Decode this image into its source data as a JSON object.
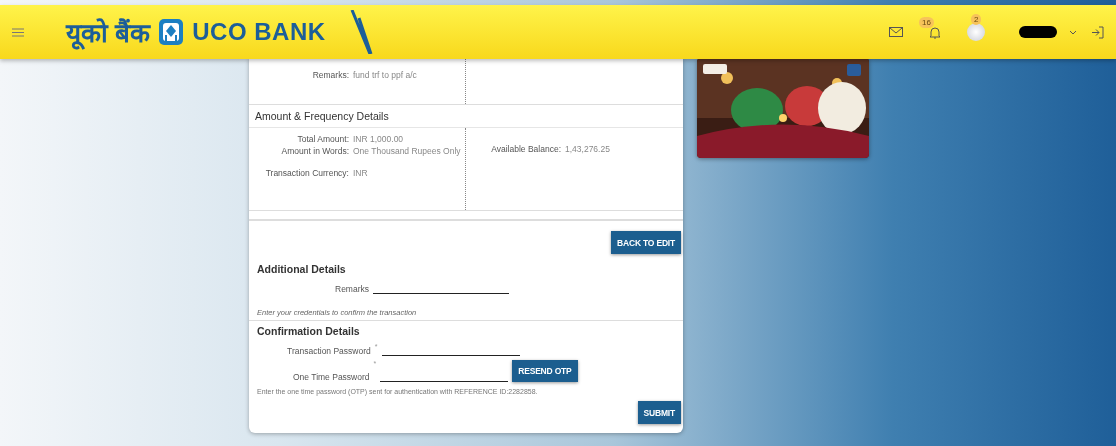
{
  "header": {
    "brand_hindi": "यूको बैंक",
    "brand_english": "UCO BANK",
    "notifications_count": "16",
    "profile_count": "2"
  },
  "summary": {
    "top_rows": [
      {
        "label": "Remarks:",
        "value": "fund trf to ppf a/c"
      }
    ],
    "amount_title": "Amount & Frequency Details",
    "left_rows": [
      {
        "label": "Total Amount:",
        "value": "INR 1,000.00"
      },
      {
        "label": "Amount in Words:",
        "value": "One Thousand Rupees Only"
      },
      {
        "label": "Transaction Currency:",
        "value": "INR"
      }
    ],
    "right_rows": [
      {
        "label": "Available Balance:",
        "value": "1,43,276.25"
      }
    ]
  },
  "back_button": "BACK TO EDIT",
  "additional": {
    "title": "Additional Details",
    "remarks_label": "Remarks"
  },
  "instruction": "Enter your credentials to confirm the transaction",
  "confirmation": {
    "title": "Confirmation Details",
    "fields": [
      {
        "kind": "password",
        "label": "Transaction Password",
        "required_mark": "*"
      },
      {
        "kind": "otp",
        "label": "One Time Password",
        "required_mark": "*"
      }
    ],
    "resend_button": "RESEND OTP",
    "note": "Enter the one time password (OTP) sent for authentication with REFERENCE ID:2282858."
  },
  "submit_button": "SUBMIT"
}
